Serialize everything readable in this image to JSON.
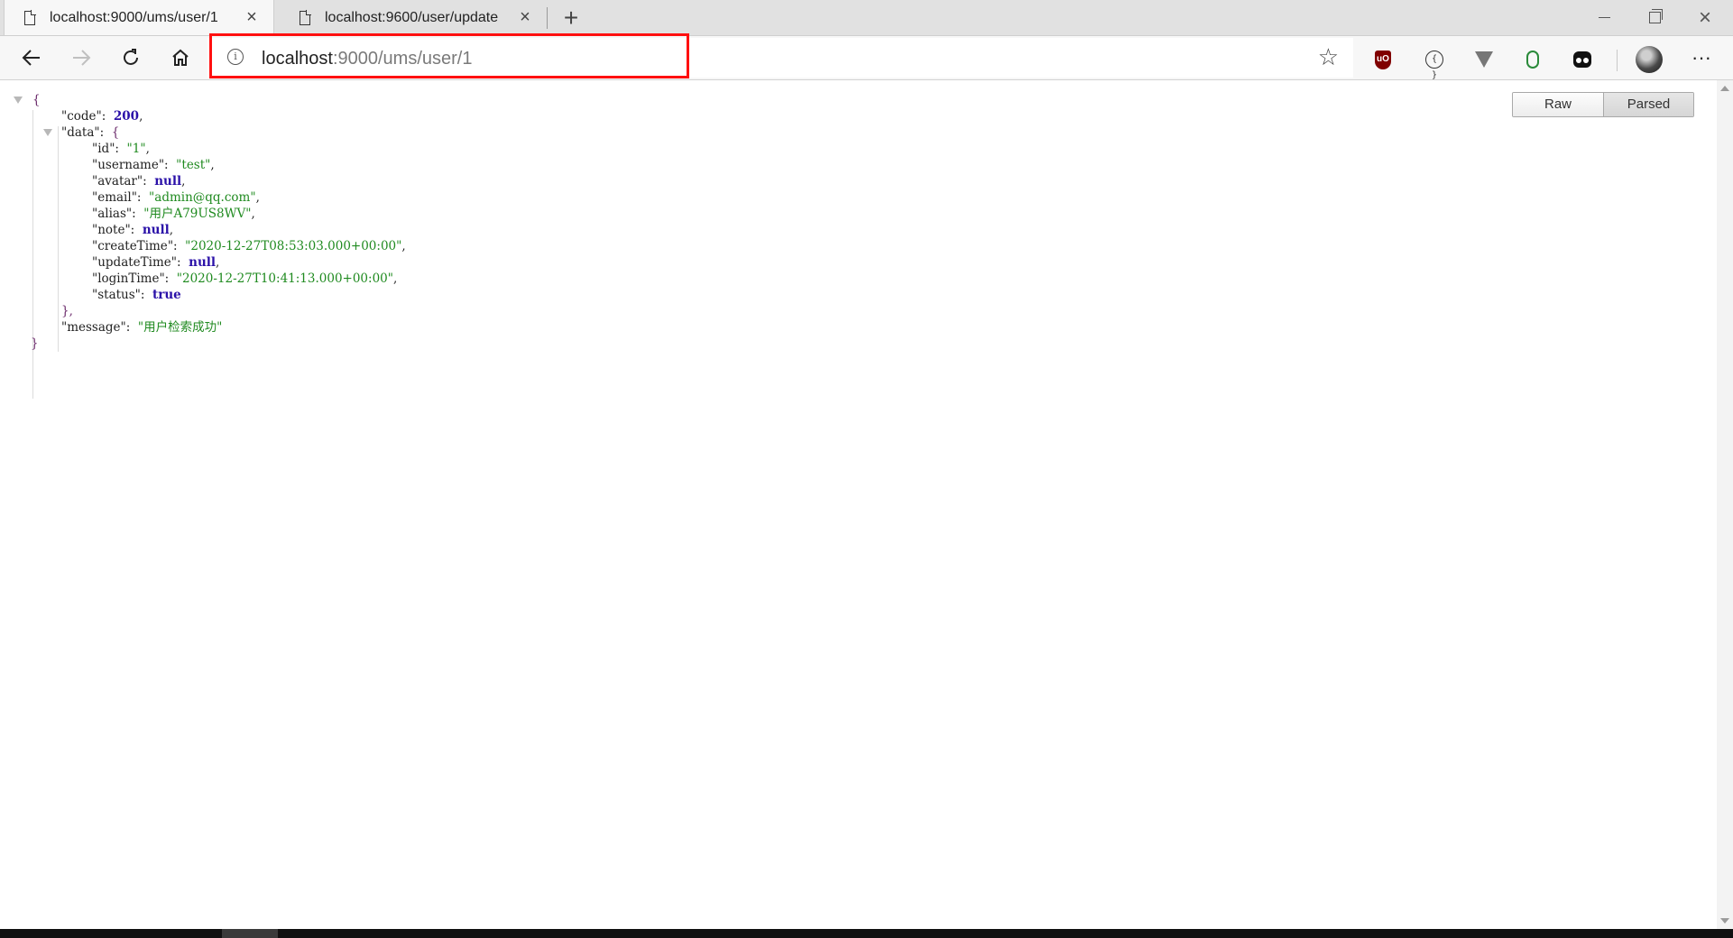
{
  "tabs": [
    {
      "title": "localhost:9000/ums/user/1",
      "active": true
    },
    {
      "title": "localhost:9600/user/update",
      "active": false
    }
  ],
  "address_bar": {
    "host": "localhost",
    "rest": ":9000/ums/user/1"
  },
  "view_toggle": {
    "raw": "Raw",
    "parsed": "Parsed",
    "selected": "Parsed"
  },
  "json_view": {
    "open_brace": "{",
    "close_brace": "}",
    "code": {
      "key": "code",
      "value": "200"
    },
    "data": {
      "key": "data",
      "open": "{",
      "close": "},",
      "fields": [
        {
          "key": "id",
          "value": "1",
          "type": "string"
        },
        {
          "key": "username",
          "value": "test",
          "type": "string"
        },
        {
          "key": "avatar",
          "value": "null",
          "type": "null"
        },
        {
          "key": "email",
          "value": "admin@qq.com",
          "type": "string"
        },
        {
          "key": "alias",
          "value": "用户A79US8WV",
          "type": "string"
        },
        {
          "key": "note",
          "value": "null",
          "type": "null"
        },
        {
          "key": "createTime",
          "value": "2020-12-27T08:53:03.000+00:00",
          "type": "string"
        },
        {
          "key": "updateTime",
          "value": "null",
          "type": "null"
        },
        {
          "key": "loginTime",
          "value": "2020-12-27T10:41:13.000+00:00",
          "type": "string"
        },
        {
          "key": "status",
          "value": "true",
          "type": "bool"
        }
      ]
    },
    "message": {
      "key": "message",
      "value": "用户检索成功"
    }
  },
  "icons": [
    "page-icon",
    "close-icon",
    "plus-icon",
    "minimize-icon",
    "restore-icon",
    "window-close-icon",
    "back-arrow-icon",
    "forward-arrow-icon",
    "refresh-icon",
    "home-icon",
    "info-icon",
    "star-icon",
    "ublock-icon",
    "code-icon",
    "vue-icon",
    "evernote-icon",
    "mask-icon",
    "avatar",
    "more-icon"
  ],
  "colors": {
    "highlight": "#ff1010",
    "string": "#1f8a1f",
    "keyword": "#2a10a8",
    "brace": "#6b2a6b"
  }
}
